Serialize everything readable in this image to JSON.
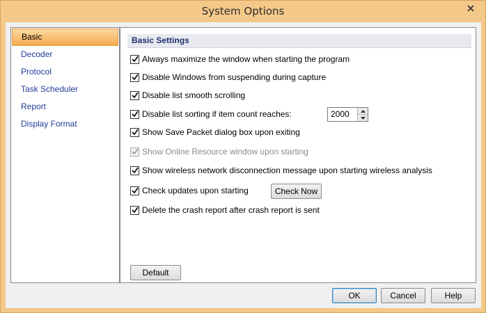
{
  "window": {
    "title": "System Options"
  },
  "sidebar": {
    "items": [
      {
        "label": "Basic",
        "active": true
      },
      {
        "label": "Decoder"
      },
      {
        "label": "Protocol"
      },
      {
        "label": "Task Scheduler"
      },
      {
        "label": "Report"
      },
      {
        "label": "Display Format"
      }
    ]
  },
  "panel": {
    "section_title": "Basic Settings",
    "options": [
      {
        "label": "Always maximize the window when starting the program",
        "checked": true
      },
      {
        "label": "Disable Windows from suspending during capture",
        "checked": true
      },
      {
        "label": "Disable list smooth scrolling",
        "checked": true
      },
      {
        "label": "Disable list sorting if item count reaches:",
        "checked": true
      },
      {
        "label": "Show Save Packet dialog box upon exiting",
        "checked": true
      },
      {
        "label": "Show Online Resource window upon starting",
        "checked": true,
        "disabled": true
      },
      {
        "label": "Show wireless network disconnection message upon starting wireless analysis",
        "checked": true
      },
      {
        "label": "Check updates upon starting",
        "checked": true
      },
      {
        "label": "Delete the crash report after crash report is sent",
        "checked": true
      }
    ],
    "sort_count": "2000",
    "check_now_label": "Check Now",
    "default_label": "Default"
  },
  "footer": {
    "ok_label": "OK",
    "cancel_label": "Cancel",
    "help_label": "Help"
  }
}
